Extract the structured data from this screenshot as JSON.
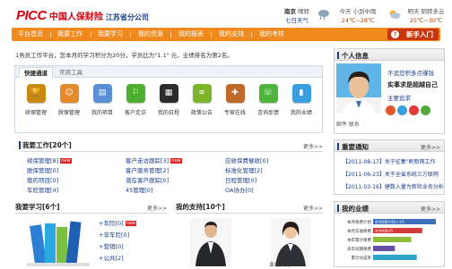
{
  "header": {
    "logo_brand": "PICC",
    "logo_name": "中国人保财险",
    "branch": "江苏省分公司"
  },
  "weather": [
    {
      "city": "南京",
      "state": "晴转",
      "date": "七日天气"
    },
    {
      "label": "今天 小到中雨",
      "temp": "24℃~28℃"
    },
    {
      "label": "明天 阴转多云",
      "temp": "25℃~30℃"
    }
  ],
  "nav": {
    "items": [
      "平台首页",
      "我要工作",
      "我要学习",
      "我的资源",
      "我的报表",
      "我的支持",
      "我的考核"
    ],
    "newbie_label": "新手入门"
  },
  "welcome": {
    "text": "1务员工作平台，您本月的学习积分为20分，学员比为\"1.1\" 元，业绩排名为第2名。"
  },
  "quick_tools": {
    "tabs": [
      "快捷通道",
      "常用工具"
    ],
    "apps": [
      {
        "label": "续保管理",
        "icon": "trophy-icon",
        "color": "#c98a14"
      },
      {
        "label": "脱保管理",
        "icon": "user-orange-icon",
        "color": "#e38a2a"
      },
      {
        "label": "我的项目",
        "icon": "folder-icon",
        "color": "#5b8fd4"
      },
      {
        "label": "客户走访",
        "icon": "walking-icon",
        "color": "#4caf2e"
      },
      {
        "label": "我的日程",
        "icon": "calendar-icon",
        "color": "#2b2b2b"
      },
      {
        "label": "政策公告",
        "icon": "signal-icon",
        "color": "#7cb42a"
      },
      {
        "label": "专家在线",
        "icon": "expert-icon",
        "color": "#c06a2a"
      },
      {
        "label": "咨询反馈",
        "icon": "phone-icon",
        "color": "#4cb43a"
      },
      {
        "label": "我的业绩",
        "icon": "chart-icon",
        "color": "#3a9fe0"
      }
    ]
  },
  "work": {
    "title": "我要工作[20个]",
    "more": "更多>>",
    "columns": [
      [
        "续保管理[8]",
        "脱保管理[0]",
        "我的项目[0]",
        "车险管理[4]"
      ],
      [
        "客户走访跟踪[3]",
        "客户服务管理[2]",
        "潜在客户跟踪[0]",
        "45管理[0]"
      ],
      [
        "应收保费催收[0]",
        "标准化管理[2]",
        "日程管理[0]",
        "OA协办[0]"
      ]
    ],
    "new_tag": "new"
  },
  "profile": {
    "title": "个人信息",
    "links": [
      "不追您积多点赚钱",
      "实事求是超越自己",
      "主要追求"
    ],
    "contact": "邮件 联系"
  },
  "notices": {
    "title": "重要通知",
    "more": "更多>>",
    "items": [
      "【2011-08-17】关于征集\"刷新网工作",
      "【2011-06-23】关于全省系统三方联网",
      "【2011-03-16】健数入量为新险业务分析"
    ]
  },
  "study": {
    "title": "我要学习[6个]",
    "more": "更多>>",
    "items": [
      "+车险[0]",
      "+非车险[0]",
      "+营销[0]",
      "+公共[2]"
    ]
  },
  "support": {
    "title": "我的支持[10个]",
    "more": "更多>>",
    "caption_right": "业务员方"
  },
  "performance": {
    "title": "我的业绩",
    "more": "更多>>"
  },
  "chart_data": {
    "type": "bar",
    "orientation": "horizontal",
    "categories": [
      "本月保费计划",
      "本月实收保费",
      "本年累计保费",
      "去年同期保费",
      "累计达成率"
    ],
    "values": [
      11.5,
      9.0,
      7.0,
      4.0,
      8.0
    ],
    "colors": [
      "#3e6fbd",
      "#d43c3c",
      "#8fbd3a",
      "#6a4fa8",
      "#2fa3c9"
    ],
    "data_labels": [
      "本月保费计划11.5万",
      "本月实收9万",
      "",
      "",
      ""
    ]
  }
}
